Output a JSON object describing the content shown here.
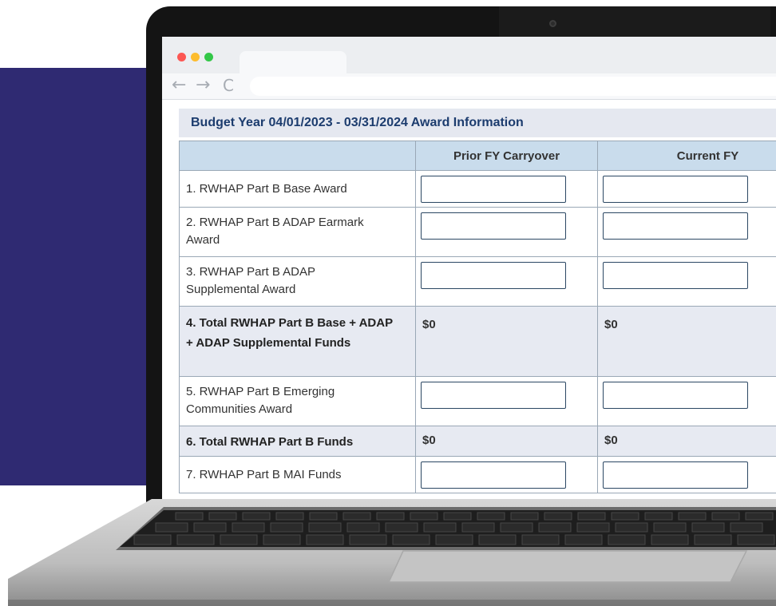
{
  "browser": {
    "traffic_lights": [
      "#fc5753",
      "#fdbc2e",
      "#33c748"
    ],
    "nav": {
      "back_icon": "←",
      "forward_icon": "→",
      "reload_icon": "C"
    }
  },
  "page": {
    "title": "Budget Year 04/01/2023 - 03/31/2024 Award Information"
  },
  "table": {
    "headers": [
      "",
      "Prior FY Carryover",
      "Current FY"
    ],
    "rows": [
      {
        "label": "1. RWHAP Part B Base Award"
      },
      {
        "label": "2. RWHAP Part B ADAP Earmark Award"
      },
      {
        "label": "3. RWHAP Part B ADAP Supplemental Award"
      },
      {
        "label": "4. Total RWHAP Part B Base + ADAP + ADAP Supplemental Funds",
        "prior": "$0",
        "current": "$0"
      },
      {
        "label": "5. RWHAP Part B Emerging Communities Award"
      },
      {
        "label": "6. Total RWHAP Part B Funds",
        "prior": "$0",
        "current": "$0"
      },
      {
        "label": "7. RWHAP Part B MAI Funds"
      }
    ]
  },
  "colors": {
    "brand_navy": "#1c3c6e",
    "header_blue": "#c9dcec",
    "purple_block": "#2f2a72"
  }
}
